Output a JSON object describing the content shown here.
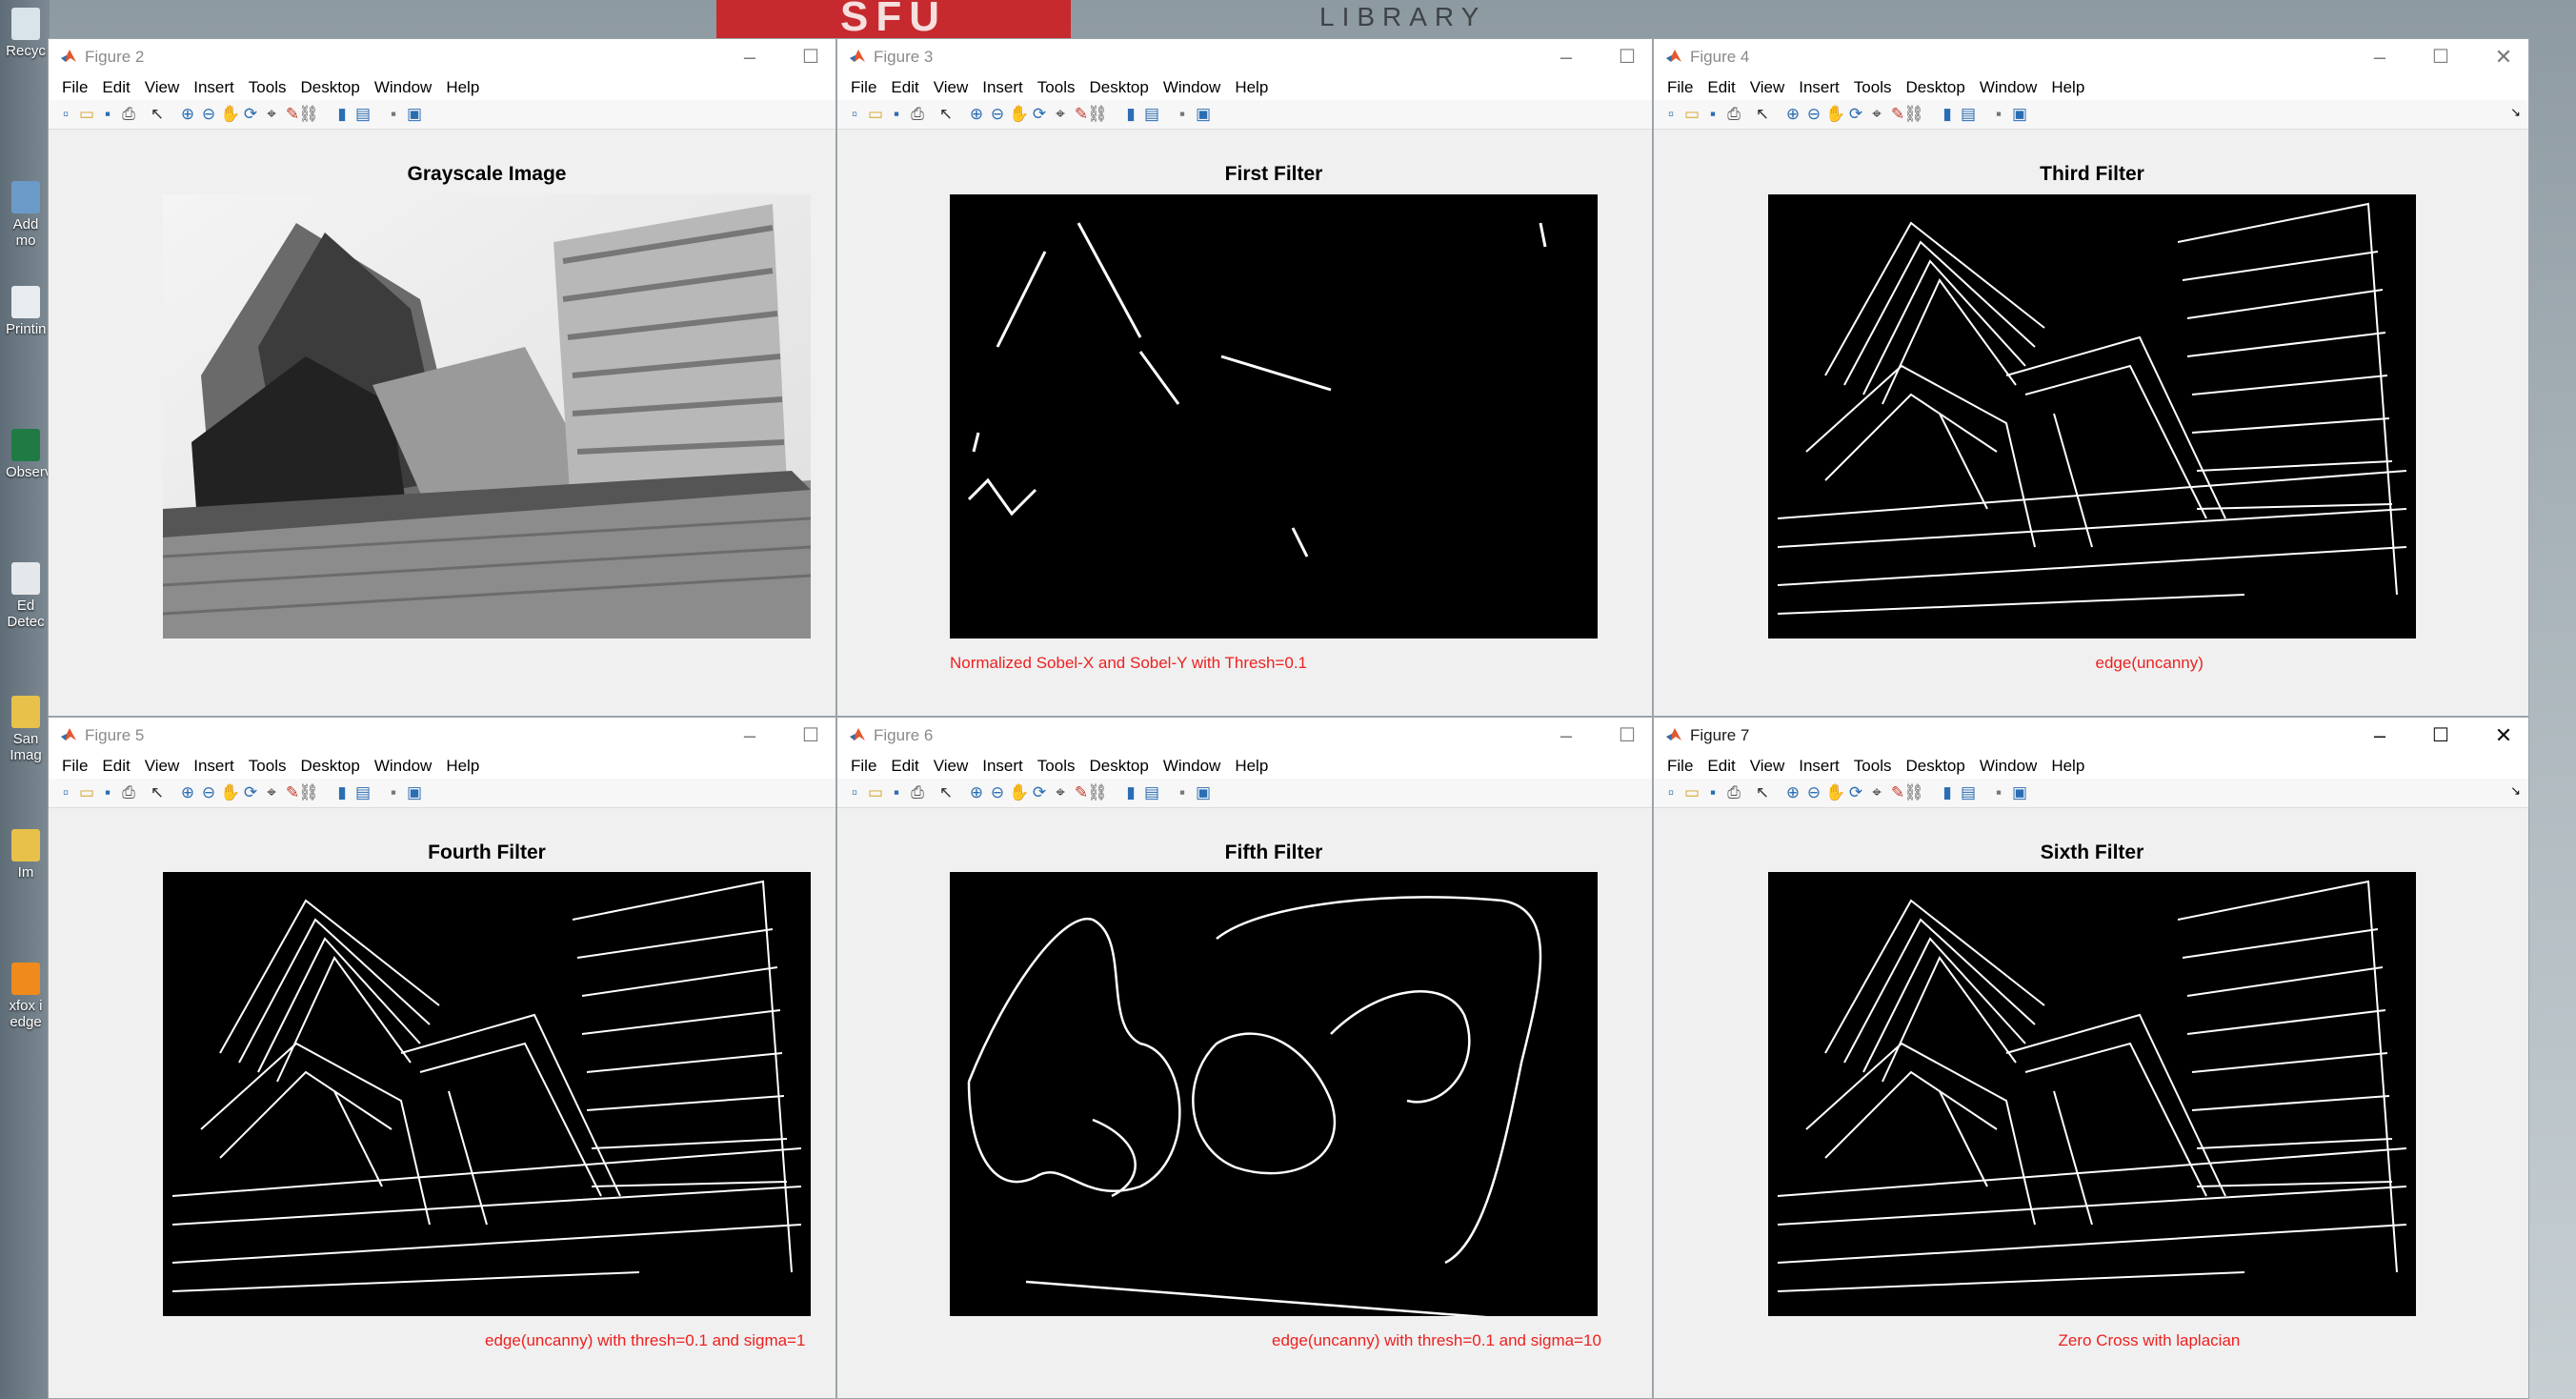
{
  "background": {
    "banner_text": "SFU",
    "library_text": "LIBRARY",
    "desktop_icons": [
      "Recyc",
      "Add mo",
      "Printin",
      "Observ",
      "Ed Detec",
      "San Imag",
      "Im",
      "xfox i edge"
    ]
  },
  "menus": [
    "File",
    "Edit",
    "View",
    "Insert",
    "Tools",
    "Desktop",
    "Window",
    "Help"
  ],
  "windows": [
    {
      "title": "Figure 2",
      "axes_title": "Grayscale Image",
      "caption": "",
      "image": "grayscale-building"
    },
    {
      "title": "Figure 3",
      "axes_title": "First Filter",
      "caption": "Normalized Sobel-X and Sobel-Y with Thresh=0.1",
      "image": "sparse-edges"
    },
    {
      "title": "Figure 4",
      "axes_title": "Third Filter",
      "caption": "edge(uncanny)",
      "image": "dense-edges"
    },
    {
      "title": "Figure 5",
      "axes_title": "Fourth Filter",
      "caption": "edge(uncanny) with thresh=0.1 and sigma=1",
      "image": "dense-edges"
    },
    {
      "title": "Figure 6",
      "axes_title": "Fifth Filter",
      "caption": "edge(uncanny) with thresh=0.1 and sigma=10",
      "image": "blob-edges"
    },
    {
      "title": "Figure 7",
      "axes_title": "Sixth Filter",
      "caption": "Zero Cross with laplacian",
      "image": "dense-edges"
    }
  ],
  "toolbar_icons": [
    "new-figure-icon",
    "open-icon",
    "save-icon",
    "print-icon",
    "select-arrow-icon",
    "zoom-in-icon",
    "zoom-out-icon",
    "pan-icon",
    "rotate-icon",
    "data-cursor-icon",
    "brush-icon",
    "link-plot-icon",
    "colorbar-icon",
    "legend-icon",
    "hide-plot-tools-icon",
    "show-plot-tools-icon"
  ],
  "colors": {
    "caption": "#ee2020",
    "window_bg": "#f0f0f0",
    "accent_banner": "#c62a2e"
  }
}
